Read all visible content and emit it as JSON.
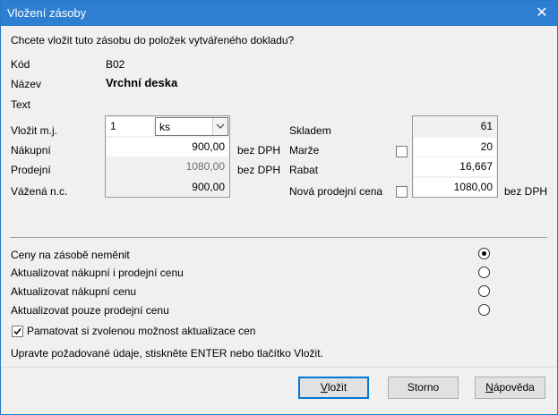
{
  "window": {
    "title": "Vložení zásoby",
    "close_glyph": "✕"
  },
  "question": "Chcete vložit tuto zásobu do položek vytvářeného dokladu?",
  "info": {
    "code_label": "Kód",
    "code_value": "B02",
    "name_label": "Název",
    "name_value": "Vrchní deska",
    "text_label": "Text"
  },
  "left": {
    "unit_label": "Vložit m.j.",
    "unit_qty": "1",
    "unit_value": "ks",
    "purchase_label": "Nákupní",
    "purchase_value": "900,00",
    "purchase_suffix": "bez DPH",
    "sale_label": "Prodejní",
    "sale_value": "1080,00",
    "sale_suffix": "bez DPH",
    "weighted_label": "Vážená n.c.",
    "weighted_value": "900,00"
  },
  "right": {
    "stock_label": "Skladem",
    "stock_value": "61",
    "margin_label": "Marže",
    "margin_value": "20",
    "discount_label": "Rabat",
    "discount_value": "16,667",
    "newprice_label": "Nová prodejní cena",
    "newprice_value": "1080,00",
    "newprice_suffix": "bez DPH"
  },
  "options": [
    {
      "label": "Ceny na zásobě neměnit",
      "selected": true
    },
    {
      "label": "Aktualizovat nákupní i prodejní cenu",
      "selected": false
    },
    {
      "label": "Aktualizovat nákupní cenu",
      "selected": false
    },
    {
      "label": "Aktualizovat pouze prodejní cenu",
      "selected": false
    }
  ],
  "remember": {
    "label": "Pamatovat si zvolenou možnost aktualizace cen",
    "checked": true
  },
  "hint": "Upravte požadované údaje, stiskněte ENTER nebo tlačítko Vložit.",
  "buttons": {
    "insert_first": "V",
    "insert_rest": "ložit",
    "cancel": "Storno",
    "help_first": "N",
    "help_rest": "ápověda"
  },
  "colors": {
    "titlebar": "#2e7fd1",
    "accent": "#0078d7"
  }
}
